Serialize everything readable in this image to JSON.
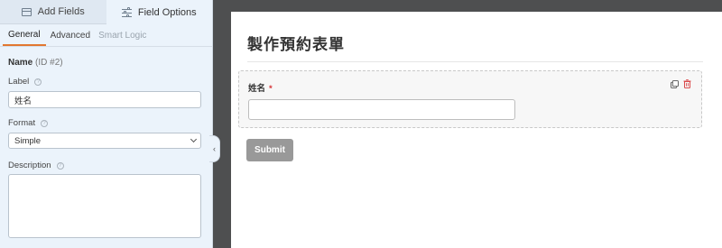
{
  "top_tabs": [
    {
      "label": "Add Fields",
      "icon": "table-icon"
    },
    {
      "label": "Field Options",
      "icon": "sliders-icon"
    }
  ],
  "sub_tabs": [
    "General",
    "Advanced",
    "Smart Logic"
  ],
  "field": {
    "name": "Name",
    "id": "(ID #2)"
  },
  "label": {
    "title": "Label",
    "value": "姓名"
  },
  "format": {
    "title": "Format",
    "selected": "Simple"
  },
  "description": {
    "title": "Description",
    "value": ""
  },
  "preview": {
    "form_title": "製作預約表單",
    "field_label": "姓名",
    "required_mark": "*",
    "submit_label": "Submit"
  },
  "colors": {
    "accent": "#e27730",
    "required": "#d63638",
    "panel": "#ebf3fb"
  }
}
